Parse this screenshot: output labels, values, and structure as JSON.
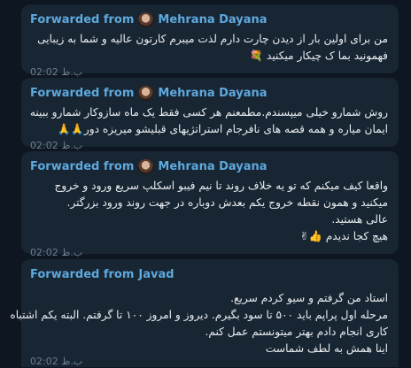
{
  "messages": [
    {
      "forwarded_label": "Forwarded from",
      "sender": "Mehrana Dayana",
      "lines": [
        "من برای اولین بار از دیدن چارت دارم لذت میبرم کارتون عالیه و شما به زیبایی",
        "فهمونید بما ک چیکار میکنید 💐"
      ],
      "time": "02:02 ب.ظ"
    },
    {
      "forwarded_label": "Forwarded from",
      "sender": "Mehrana Dayana",
      "lines": [
        "روش شمارو خیلی میپسندم.مطمعنم هر کسی فقط یک ماه سازوکار شمارو ببینه",
        "ایمان میاره و همه قصه های نافرجام استراتژیهای قبلیشو میریزه دور🙏🙏"
      ],
      "time": "02:02 ب.ظ"
    },
    {
      "forwarded_label": "Forwarded from",
      "sender": "Mehrana Dayana",
      "lines": [
        "واقعا کیف میکنم که تو یه خلاف روند تا نیم فیبو اسکلپ سریع ورود و خروج",
        "میکنید و همون نقطه خروج یکم بعدش دوباره در جهت روند ورود بزرگتر.",
        "عالی هستید.",
        "هیچ کجا ندیدم 👍✌"
      ],
      "time": "02:02 ب.ظ"
    },
    {
      "forwarded_label": "Forwarded from",
      "sender": "Javad",
      "lines": [
        "استاد من گرفتم و سیو کردم سریع.",
        "مرحله اول پراپم باید ۵۰۰ تا سود بگیرم. دیروز و امروز ۱۰۰ تا گرفتم. البته یکم اشتباه",
        "کاری انجام دادم بهتر میتونستم عمل کنم.",
        "اینا همش به لطف شماست"
      ],
      "time": "02:02 ب.ظ"
    }
  ]
}
